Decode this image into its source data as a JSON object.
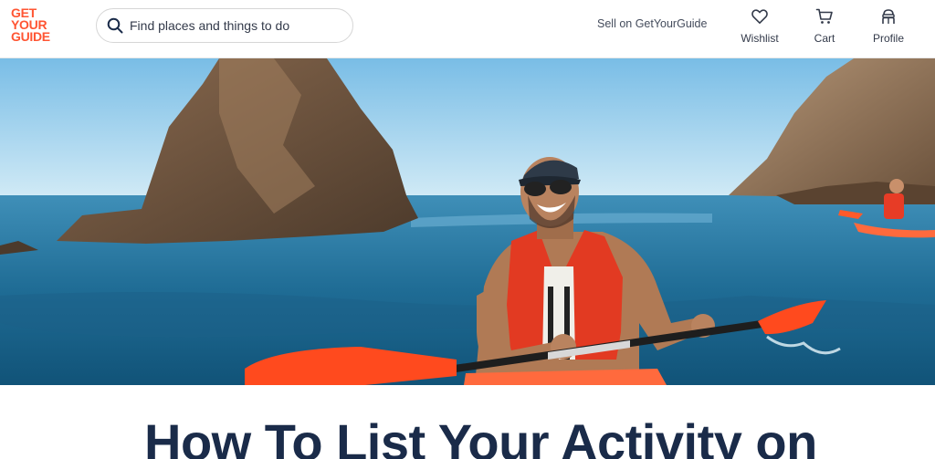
{
  "header": {
    "logo_lines": [
      "GET",
      "YOUR",
      "GUIDE"
    ],
    "search_placeholder": "Find places and things to do",
    "sell_link": "Sell on GetYourGuide",
    "nav": {
      "wishlist": "Wishlist",
      "cart": "Cart",
      "profile": "Profile"
    }
  },
  "colors": {
    "brand": "#ff5533",
    "title": "#1a2b49"
  },
  "icons": {
    "search": "search-icon",
    "wishlist": "heart-icon",
    "cart": "cart-icon",
    "profile": "profile-icon"
  },
  "main": {
    "title": "How To List Your Activity on"
  }
}
